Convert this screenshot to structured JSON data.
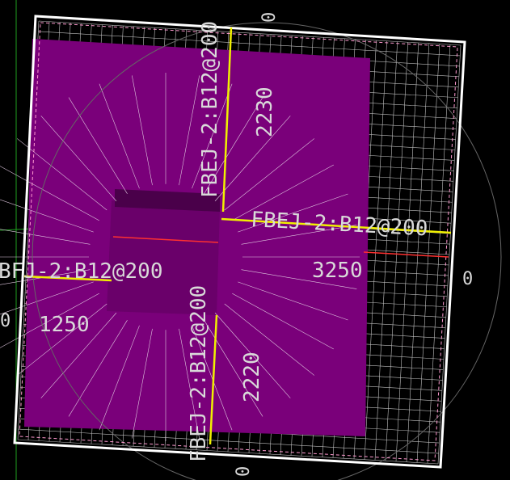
{
  "colors": {
    "background": "#000000",
    "slab_fill": "#7a007a",
    "column_fill": "#6a006a",
    "mesh": "#d8d8d8",
    "rebar": "#f0f000",
    "boundary": "#ffffff",
    "section_cut": "#ff3030",
    "axis": "#1fa01f",
    "text": "#d9d9d9"
  },
  "labels": {
    "rebar_top_vertical": "FBEJ-2:B12@200",
    "rebar_right_horizontal": "FBEJ-2:B12@200",
    "rebar_left_horizontal": "BFJ-2:B12@200",
    "rebar_bottom_vertical": "FBEJ-2:B12@200",
    "dim_top": "2230",
    "dim_right": "3250",
    "dim_left": "1250",
    "dim_bottom": "2220",
    "zero_top": "0",
    "zero_right": "0",
    "zero_left": "0",
    "zero_bottom": "0"
  }
}
